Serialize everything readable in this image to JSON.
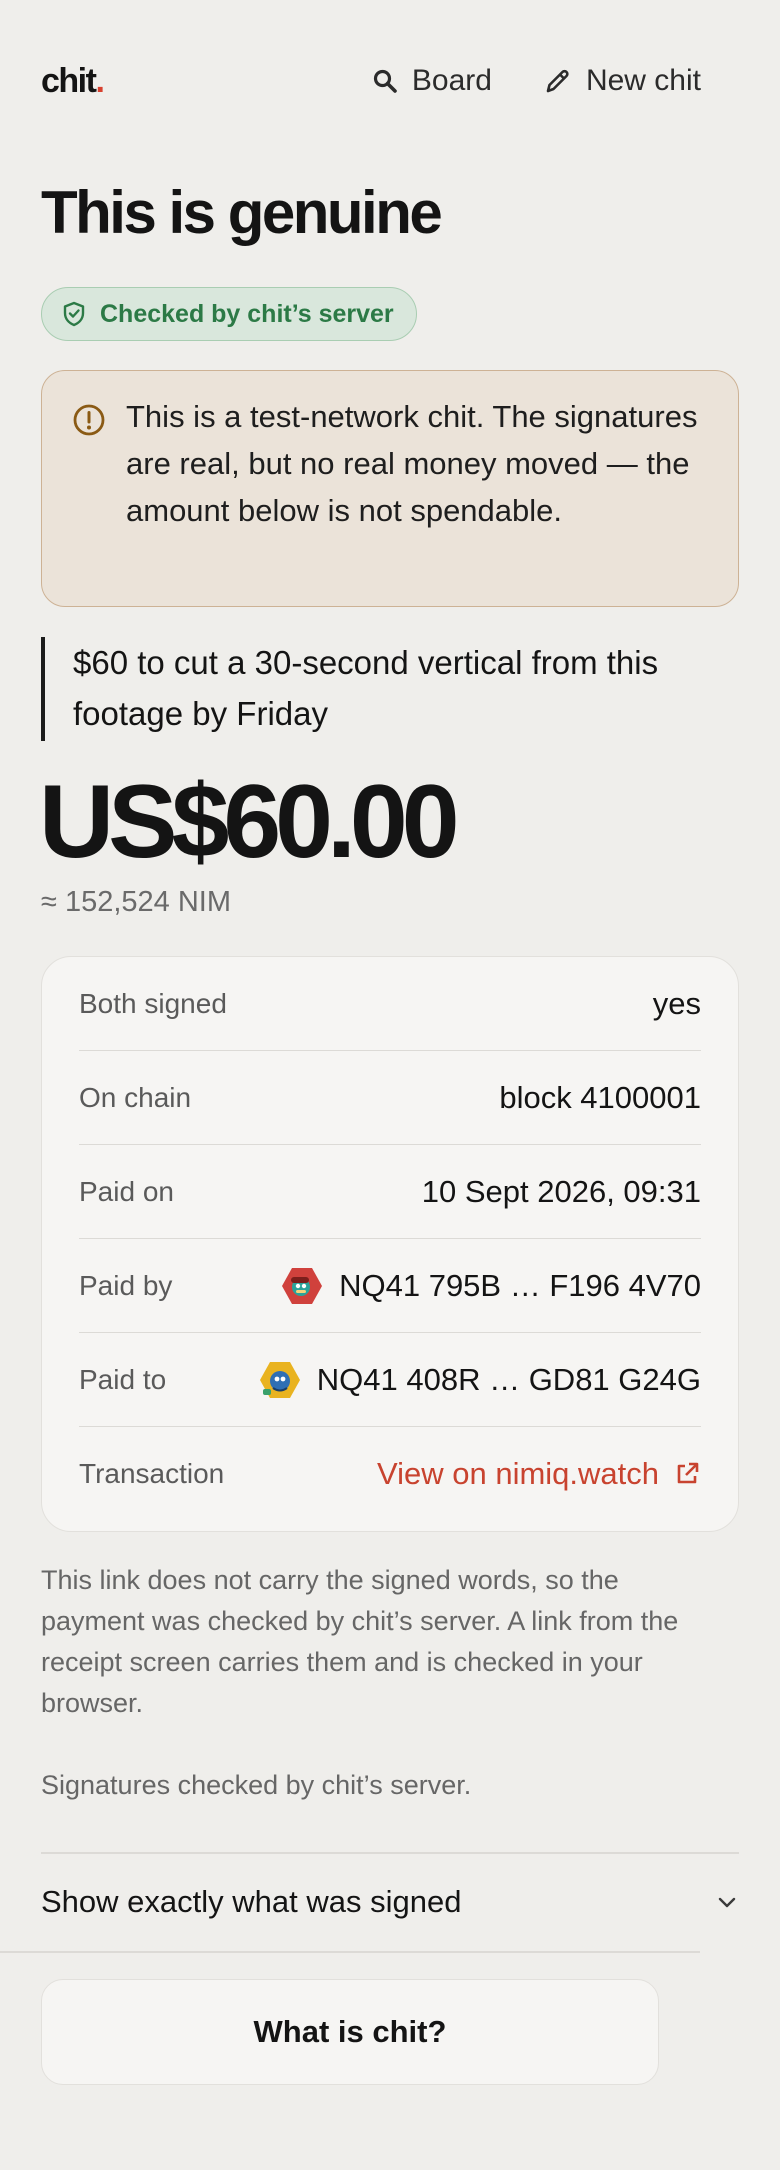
{
  "header": {
    "logo_text": "chit",
    "logo_dot": ".",
    "nav": [
      {
        "label": "Board",
        "icon": "search-icon"
      },
      {
        "label": "New chit",
        "icon": "pencil-icon"
      }
    ]
  },
  "page_title": "This is genuine",
  "badge": {
    "label": "Checked by chit’s server",
    "icon": "shield-check-icon",
    "color": "#2c7a46"
  },
  "notice": {
    "text": "This is a test-network chit. The signatures are real, but no real money moved — the amount below is not spendable.",
    "icon": "warning-circle-icon"
  },
  "description": "$60 to cut a 30-second vertical from this footage by Friday",
  "amount": "US$60.00",
  "approx": "≈ 152,524 NIM",
  "details": {
    "both_signed": {
      "label": "Both signed",
      "value": "yes"
    },
    "on_chain": {
      "label": "On chain",
      "value": "block 4100001"
    },
    "paid_on": {
      "label": "Paid on",
      "value": "10 Sept 2026, 09:31"
    },
    "paid_by": {
      "label": "Paid by",
      "value": "NQ41 795B … F196 4V70"
    },
    "paid_to": {
      "label": "Paid to",
      "value": "NQ41 408R … GD81 G24G"
    },
    "transaction": {
      "label": "Transaction",
      "link": "View on nimiq.watch",
      "icon": "external-link-icon"
    }
  },
  "info_text": "This link does not carry the signed words, so the payment was checked by chit’s server. A link from the receipt screen carries them and is checked in your browser.",
  "info_text2": "Signatures checked by chit’s server.",
  "disclosure_label": "Show exactly what was signed",
  "cta_label": "What is chit?",
  "colors": {
    "accent": "#c8432f",
    "background": "#efeeeb",
    "success": "#2c7a46"
  }
}
